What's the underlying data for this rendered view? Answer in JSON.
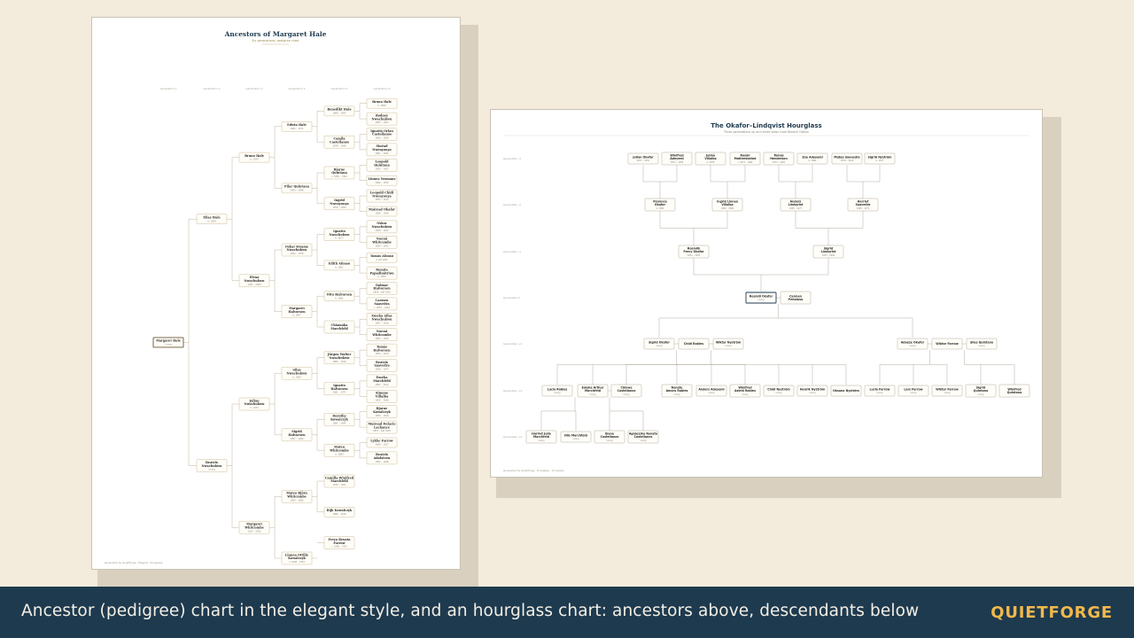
{
  "pedigree": {
    "title": "Ancestors of Margaret Hale",
    "subtitle": "Six generations, pedigree chart",
    "generation_labels": [
      "Generation 1",
      "Generation 2",
      "Generation 3",
      "Generation 4",
      "Generation 5",
      "Generation 6"
    ],
    "footer": "Generated by QuietForge · Elegant · 63 people",
    "people": [
      {
        "id": "p1",
        "gen": 1,
        "name": "Margaret Hale",
        "dates": "Living",
        "root": true
      },
      {
        "id": "p2",
        "gen": 2,
        "name": "Elias Hale",
        "dates": "b. 1958"
      },
      {
        "id": "p3",
        "gen": 2,
        "name": "Beatrix Nwachukwu",
        "dates": "Living"
      },
      {
        "id": "p4",
        "gen": 3,
        "name": "Bruno Hale",
        "dates": "b. 1929"
      },
      {
        "id": "p5",
        "gen": 3,
        "name": "Elena Nwachukwu",
        "dates": "1927 – 2009"
      },
      {
        "id": "p6",
        "gen": 3,
        "name": "Julian Nwachukwu",
        "dates": "b. 1934"
      },
      {
        "id": "p7",
        "gen": 3,
        "name": "Margaret Whitcombe",
        "dates": "1937 – 2003"
      },
      {
        "id": "p8",
        "gen": 4,
        "name": "Edwin Hale",
        "dates": "1902 – 1971"
      },
      {
        "id": "p9",
        "gen": 4,
        "name": "Pilar Quintana",
        "dates": "1905 – 1988"
      },
      {
        "id": "p10",
        "gen": 4,
        "name": "Oskar Kwame Nwachukwu",
        "dates": "1904 – 1976"
      },
      {
        "id": "p11",
        "gen": 4,
        "name": "Margaret Halvorsen",
        "dates": "b. 1907"
      },
      {
        "id": "p12",
        "gen": 4,
        "name": "Silas Nwachukwu",
        "dates": "b. 1909"
      },
      {
        "id": "p13",
        "gen": 4,
        "name": "Sigrid Halvorsen",
        "dates": "1907 – 1994"
      },
      {
        "id": "p14",
        "gen": 4,
        "name": "Mateo Björn Whitcombe",
        "dates": "1904 – 1983"
      },
      {
        "id": "p15",
        "gen": 4,
        "name": "Linnea Ottilie Kowalczyk",
        "dates": "c. 1908 – 1952"
      },
      {
        "id": "p16",
        "gen": 5,
        "name": "Benedikt Hale",
        "dates": "1880 – 1955"
      },
      {
        "id": "p17",
        "gen": 5,
        "name": "Camila Castellanos",
        "dates": "1878 – 1949"
      },
      {
        "id": "p18",
        "gen": 5,
        "name": "Bjarne Quintana",
        "dates": "c. 1881 – 1961"
      },
      {
        "id": "p19",
        "gen": 5,
        "name": "Ingrid Nwenyonya",
        "dates": "1879 – 1950"
      },
      {
        "id": "p20",
        "gen": 5,
        "name": "Ignatio Nwachukwu",
        "dates": "b. 1877"
      },
      {
        "id": "p21",
        "gen": 5,
        "name": "Edith Afonso",
        "dates": "b. 1881"
      },
      {
        "id": "p22",
        "gen": 5,
        "name": "Otto Halvorsen",
        "dates": "b. 1881"
      },
      {
        "id": "p23",
        "gen": 5,
        "name": "Chiamaka Marchfeld",
        "dates": ""
      },
      {
        "id": "p24",
        "gen": 5,
        "name": "Jürgen Walter Nwachukwu",
        "dates": "1883 – 1934"
      },
      {
        "id": "p25",
        "gen": 5,
        "name": "Ignatio Halvorsen",
        "dates": "1881 – 1977"
      },
      {
        "id": "p26",
        "gen": 5,
        "name": "Dorothy Kowalczyk",
        "dates": "1881 – 1945"
      },
      {
        "id": "p27",
        "gen": 5,
        "name": "Mateo Whitcombe",
        "dates": "b. 1880"
      },
      {
        "id": "p28",
        "gen": 5,
        "name": "Camilla Winifred Marchfeld",
        "dates": "1878 – 1951"
      },
      {
        "id": "p29",
        "gen": 5,
        "name": "Rijk Kowalczyk",
        "dates": "1882 – 1918"
      },
      {
        "id": "p30",
        "gen": 5,
        "name": "Freya Renata Farrow",
        "dates": "c. 1888 – 1951"
      },
      {
        "id": "p31",
        "gen": 6,
        "name": "Bruno Hale",
        "dates": "b. 1856"
      },
      {
        "id": "p32",
        "gen": 6,
        "name": "Rodney Nwachukwu",
        "dates": "1852 – 1903"
      },
      {
        "id": "p33",
        "gen": 6,
        "name": "Ignatio Orlan Castellanos",
        "dates": "1855 – 1926"
      },
      {
        "id": "p34",
        "gen": 6,
        "name": "Sinéad Nwenyonya",
        "dates": "1851 – 1932"
      },
      {
        "id": "p35",
        "gen": 6,
        "name": "Leopold Quintana",
        "dates": "1855 – 1927"
      },
      {
        "id": "p36",
        "gen": 6,
        "name": "Linnea Yeomans",
        "dates": "1852 – 1930"
      },
      {
        "id": "p37",
        "gen": 6,
        "name": "Leopold Chidi Nwenyonya",
        "dates": "1853 – 1913"
      },
      {
        "id": "p38",
        "gen": 6,
        "name": "Mairead Okafor",
        "dates": "1856 – 1929"
      },
      {
        "id": "p39",
        "gen": 6,
        "name": "Oskar Nwachukwu",
        "dates": "1849 – 1927"
      },
      {
        "id": "p40",
        "gen": 6,
        "name": "Noemi Whitcombe",
        "dates": "1854 – 1932"
      },
      {
        "id": "p41",
        "gen": 6,
        "name": "Tomás Afonso",
        "dates": "d. aft 1901"
      },
      {
        "id": "p42",
        "gen": 6,
        "name": "Renata Papadimitriou",
        "dates": "b. 1859"
      },
      {
        "id": "p43",
        "gen": 6,
        "name": "Dalmar Halvorsen",
        "dates": "1858 – bef 1901"
      },
      {
        "id": "p44",
        "gen": 6,
        "name": "Carmen Saavedra",
        "dates": "c. 1857 – 1949"
      },
      {
        "id": "p45",
        "gen": 6,
        "name": "Emeka Silas Nwachukwu",
        "dates": "1857 – 1918"
      },
      {
        "id": "p46",
        "gen": 6,
        "name": "Noemi Whitcombe",
        "dates": "1853 – 1935"
      },
      {
        "id": "p47",
        "gen": 6,
        "name": "Tomás Halvorsen",
        "dates": "1854 – 1919"
      },
      {
        "id": "p48",
        "gen": 6,
        "name": "Beatrix Saavedra",
        "dates": "1858 – 1937"
      },
      {
        "id": "p49",
        "gen": 6,
        "name": "Emeka Marchfeld",
        "dates": "1851 – 1912"
      },
      {
        "id": "p50",
        "gen": 6,
        "name": "Simone Villalba",
        "dates": "1855 – 1938"
      },
      {
        "id": "p51",
        "gen": 6,
        "name": "Bjarne Kowalczyk",
        "dates": "1853 – 1916"
      },
      {
        "id": "p52",
        "gen": 6,
        "name": "Mairead Delacie Lachance",
        "dates": "1857 – bef 1901"
      },
      {
        "id": "p53",
        "gen": 6,
        "name": "Lykke Farrow",
        "dates": "1856 – 1927"
      },
      {
        "id": "p54",
        "gen": 6,
        "name": "Beatrix Adalsteen",
        "dates": "1862 – 1948"
      }
    ]
  },
  "hourglass": {
    "title": "The Okafor–Lindqvist Hourglass",
    "subtitle": "Three generations up and three down from Rosmill Okafor",
    "footer": "Generated by QuietForge · Hourglass · 42 people",
    "generation_labels": {
      "g3": "Generation -3",
      "g2": "Generation -2",
      "g1": "Generation -1",
      "g0": "Generation 0",
      "d1": "Generation +1",
      "d2": "Generation +2",
      "d3": "Generation +3"
    },
    "people": [
      {
        "id": "h1",
        "row": "g3",
        "name": "Julian Okafor",
        "dates": "1872 – 1951"
      },
      {
        "id": "h2",
        "row": "g3",
        "name": "Winifred Adeyemi",
        "dates": "1874 – 1958"
      },
      {
        "id": "h3",
        "row": "g3",
        "name": "Julián Villalba",
        "dates": "b. 1879"
      },
      {
        "id": "h4",
        "row": "g3",
        "name": "Rosmi Mathersbeind",
        "dates": "c. 1877 – 1962"
      },
      {
        "id": "h5",
        "row": "g3",
        "name": "Tomás Henderson",
        "dates": "1873 – 1950"
      },
      {
        "id": "h6",
        "row": "g3",
        "name": "Zoe Adeyemi",
        "dates": "b. 1880"
      },
      {
        "id": "h7",
        "row": "g3",
        "name": "Mateo Saavedra",
        "dates": "1876 – 1949"
      },
      {
        "id": "h8",
        "row": "g3",
        "name": "Sigrid Nyström",
        "dates": "b. 1877"
      },
      {
        "id": "h9",
        "row": "g2",
        "name": "Florence Okafor",
        "dates": "b. 1904"
      },
      {
        "id": "h10",
        "row": "g2",
        "name": "Ingrid Linnea Villalba",
        "dates": "1906 – 1984"
      },
      {
        "id": "h11",
        "row": "g2",
        "name": "Anders Lindqvist",
        "dates": "1905 – 1977"
      },
      {
        "id": "h12",
        "row": "g2",
        "name": "Harriet Saavedra",
        "dates": "1908 – 1971"
      },
      {
        "id": "h13",
        "row": "g1",
        "name": "Rosmilk Percy Okafor",
        "dates": "1931 – 1978"
      },
      {
        "id": "h14",
        "row": "g1",
        "name": "Sigrid Lindqvist",
        "dates": "1933 – 2002"
      },
      {
        "id": "h15",
        "row": "g0",
        "name": "Rosmill Okafor",
        "dates": "Living",
        "focal": true
      },
      {
        "id": "h16",
        "row": "g0",
        "name": "Carmen Peñalosa",
        "dates": ""
      },
      {
        "id": "h17",
        "row": "d1",
        "name": "Sigrid Okafor",
        "dates": "Living"
      },
      {
        "id": "h18",
        "row": "d1",
        "name": "Chidi Rabies",
        "dates": ""
      },
      {
        "id": "h19",
        "row": "d1",
        "name": "Wiktor Nyström",
        "dates": "Living"
      },
      {
        "id": "h20",
        "row": "d1",
        "name": "Adaeze Okafor",
        "dates": "Living"
      },
      {
        "id": "h21",
        "row": "d1",
        "name": "Wiktor Farrow",
        "dates": ""
      },
      {
        "id": "h22",
        "row": "d1",
        "name": "Silas Quintana",
        "dates": "Living"
      },
      {
        "id": "h23",
        "row": "d2",
        "name": "Lucia Rabies",
        "dates": "Living"
      },
      {
        "id": "h24",
        "row": "d2",
        "name": "Emeka Arthur Marchfeld",
        "dates": "Living"
      },
      {
        "id": "h25",
        "row": "d2",
        "name": "Chinwe Castellanos",
        "dates": "Living"
      },
      {
        "id": "h26",
        "row": "d2",
        "name": "Renate Amara Rabies",
        "dates": "Living"
      },
      {
        "id": "h27",
        "row": "d2",
        "name": "Anders Adeyemi",
        "dates": "Living"
      },
      {
        "id": "h28",
        "row": "d2",
        "name": "Winifred Astrid Rabies",
        "dates": "Living"
      },
      {
        "id": "h29",
        "row": "d2",
        "name": "Chidi Nyström",
        "dates": "Living"
      },
      {
        "id": "h30",
        "row": "d2",
        "name": "Henrik Nyström",
        "dates": "Living"
      },
      {
        "id": "h31",
        "row": "d2",
        "name": "Oksana Nyström",
        "dates": ""
      },
      {
        "id": "h32",
        "row": "d2",
        "name": "Lucia Farrow",
        "dates": "Living"
      },
      {
        "id": "h33",
        "row": "d2",
        "name": "Lars Farrow",
        "dates": "Living"
      },
      {
        "id": "h34",
        "row": "d2",
        "name": "Wiktor Farrow",
        "dates": "Living"
      },
      {
        "id": "h35",
        "row": "d2",
        "name": "Sigrid Quintana",
        "dates": "Living"
      },
      {
        "id": "h36",
        "row": "d2",
        "name": "Winifred Quintana",
        "dates": ""
      },
      {
        "id": "h37",
        "row": "d3",
        "name": "Harriet Julia Marchfeld",
        "dates": "Living"
      },
      {
        "id": "h38",
        "row": "d3",
        "name": "Nils Marchfeld",
        "dates": "Living"
      },
      {
        "id": "h39",
        "row": "d3",
        "name": "Elena Castellanos",
        "dates": "Living"
      },
      {
        "id": "h40",
        "row": "d3",
        "name": "Agnieszka Renata Castellanos",
        "dates": "Living"
      }
    ]
  },
  "caption": "Ancestor (pedigree) chart in the elegant style, and an hourglass chart: ancestors above, descendants below",
  "brand": "QUIETFORGE",
  "colors": {
    "footer_bg": "#1e3a4f",
    "brand": "#f1b84a",
    "page_bg": "#f3ecdc",
    "box_border": "#c8b58a",
    "line": "#b9ad94"
  }
}
